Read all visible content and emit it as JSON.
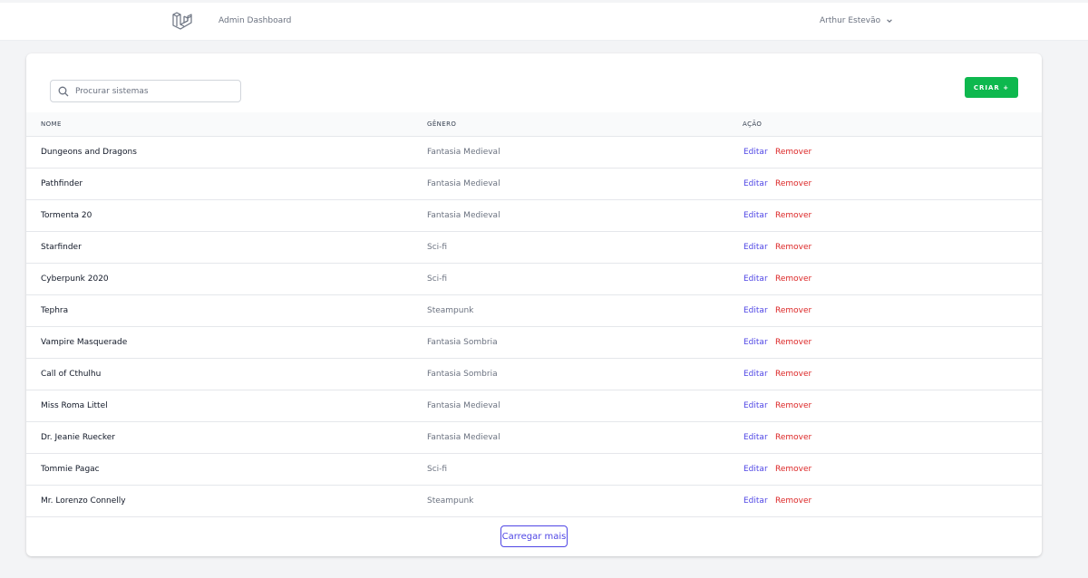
{
  "nav": {
    "link_label": "Admin Dashboard",
    "user_name": "Arthur Estevão"
  },
  "search": {
    "placeholder": "Procurar sistemas"
  },
  "toolbar": {
    "create_label": "CRIAR +"
  },
  "table": {
    "headers": [
      "NOME",
      "GÊNERO",
      "AÇÃO"
    ],
    "rows": [
      {
        "name": "Dungeons and Dragons",
        "genre": "Fantasia Medieval"
      },
      {
        "name": "Pathfinder",
        "genre": "Fantasia Medieval"
      },
      {
        "name": "Tormenta 20",
        "genre": "Fantasia Medieval"
      },
      {
        "name": "Starfinder",
        "genre": "Sci-fi"
      },
      {
        "name": "Cyberpunk 2020",
        "genre": "Sci-fi"
      },
      {
        "name": "Tephra",
        "genre": "Steampunk"
      },
      {
        "name": "Vampire Masquerade",
        "genre": "Fantasia Sombria"
      },
      {
        "name": "Call of Cthulhu",
        "genre": "Fantasia Sombria"
      },
      {
        "name": "Miss Roma Littel",
        "genre": "Fantasia Medieval"
      },
      {
        "name": "Dr. Jeanie Ruecker",
        "genre": "Fantasia Medieval"
      },
      {
        "name": "Tommie Pagac",
        "genre": "Sci-fi"
      },
      {
        "name": "Mr. Lorenzo Connelly",
        "genre": "Steampunk"
      }
    ],
    "edit_label": "Editar",
    "remove_label": "Remover"
  },
  "footer": {
    "load_more_label": "Carregar mais"
  },
  "colors": {
    "accent": "#4f46e5",
    "create_button": "#0eb84e",
    "remove_link": "#dc2626"
  }
}
